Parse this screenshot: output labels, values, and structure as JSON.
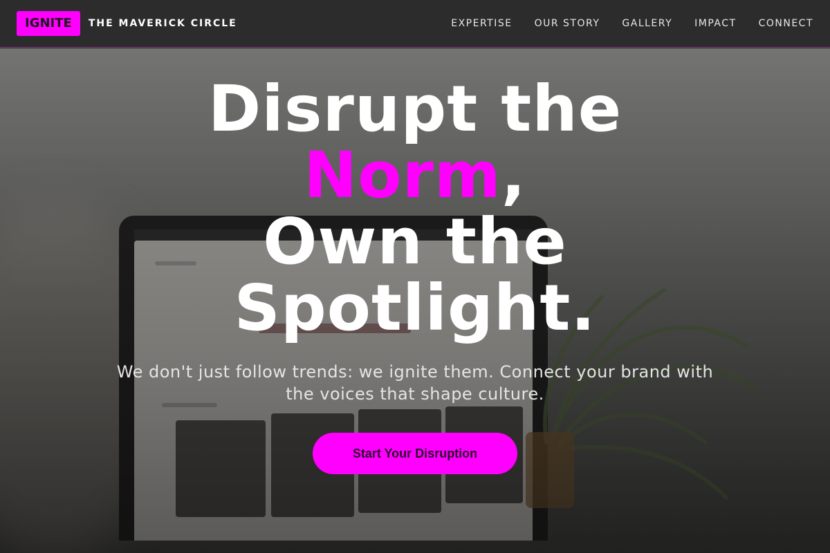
{
  "nav": {
    "logo": "IGNITE",
    "brand": "THE MAVERICK CIRCLE",
    "links": [
      "EXPERTISE",
      "OUR STORY",
      "GALLERY",
      "IMPACT",
      "CONNECT"
    ]
  },
  "hero": {
    "line1": "Disrupt the",
    "accent_word": "Norm",
    "accent_punct": ",",
    "line3": "Own the",
    "line4": "Spotlight.",
    "subtext": "We don't just follow trends: we ignite them. Connect your brand with the voices that shape culture.",
    "cta": "Start Your Disruption"
  },
  "colors": {
    "accent": "#ff00ff",
    "nav_bg": "#2c2c2c",
    "text": "#ffffff"
  }
}
